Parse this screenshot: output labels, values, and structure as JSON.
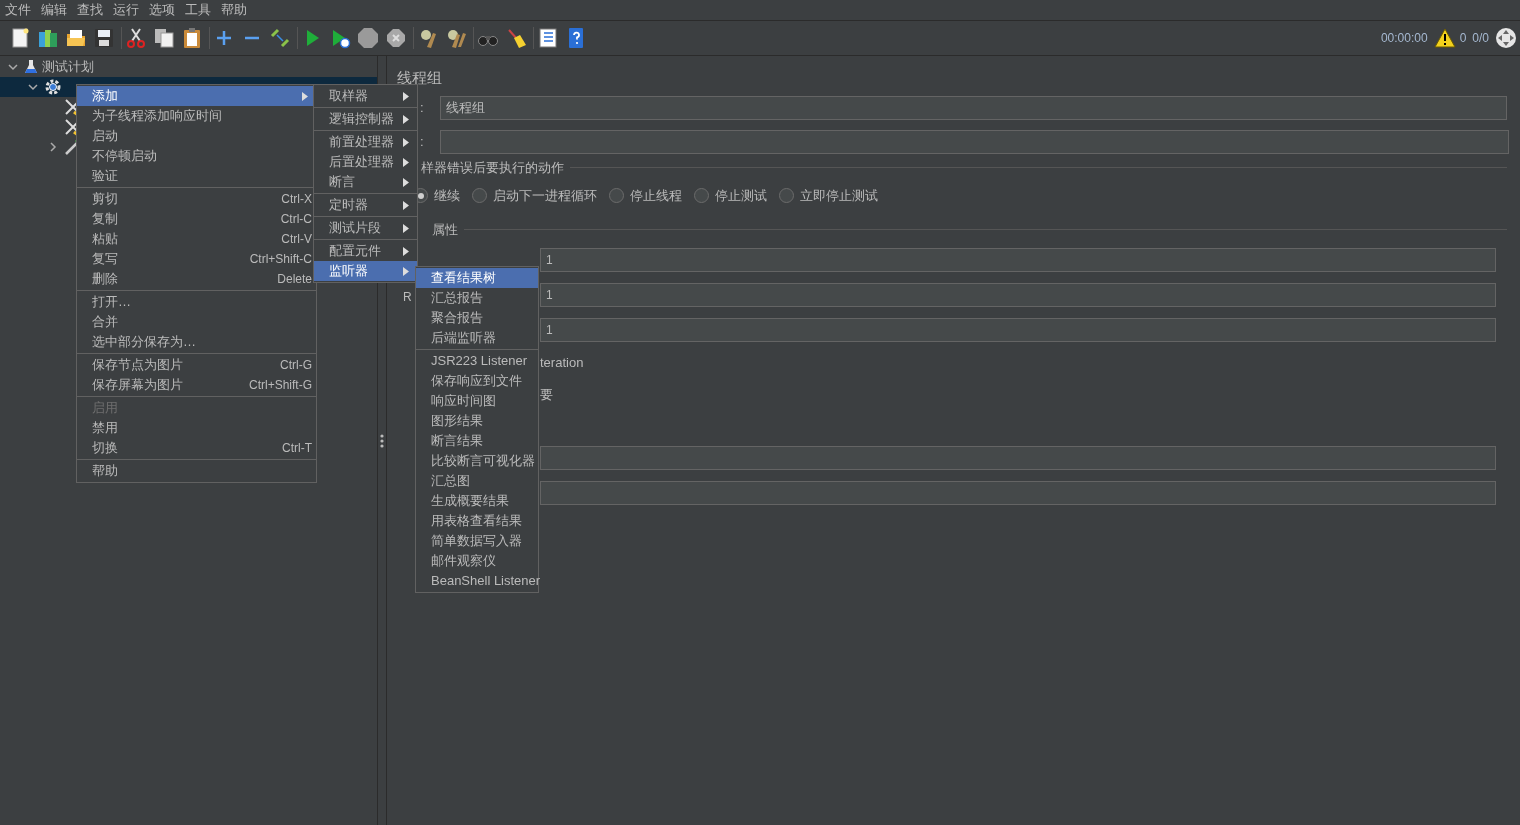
{
  "menu_bar": [
    "文件",
    "编辑",
    "查找",
    "运行",
    "选项",
    "工具",
    "帮助"
  ],
  "status": {
    "elapsed": "00:00:00",
    "warnings": "0",
    "threads": "0/0"
  },
  "tree": [
    {
      "kind": "plan",
      "label": "测试计划",
      "expanded": true,
      "selected": false,
      "children": [
        {
          "kind": "thread-group",
          "expanded": true,
          "selected": true,
          "children": [
            {
              "kind": "sampler",
              "selected": false
            },
            {
              "kind": "sampler",
              "selected": false
            },
            {
              "kind": "tool",
              "expanded": false,
              "selected": false
            }
          ]
        }
      ]
    }
  ],
  "context_menu": [
    [
      {
        "label": "添加",
        "selected": true,
        "submenu": true
      },
      {
        "label": "为子线程添加响应时间",
        "selected": false
      },
      {
        "label": "启动",
        "selected": false
      },
      {
        "label": "不停顿启动",
        "selected": false
      },
      {
        "label": "验证",
        "selected": false
      }
    ],
    [
      {
        "label": "剪切",
        "shortcut": "Ctrl-X",
        "selected": false
      },
      {
        "label": "复制",
        "shortcut": "Ctrl-C",
        "selected": false
      },
      {
        "label": "粘贴",
        "shortcut": "Ctrl-V",
        "selected": false
      },
      {
        "label": "复写",
        "shortcut": "Ctrl+Shift-C",
        "selected": false
      },
      {
        "label": "删除",
        "shortcut": "Delete",
        "selected": false
      }
    ],
    [
      {
        "label": "打开…",
        "selected": false
      },
      {
        "label": "合并",
        "selected": false
      },
      {
        "label": "选中部分保存为…",
        "selected": false
      }
    ],
    [
      {
        "label": "保存节点为图片",
        "shortcut": "Ctrl-G",
        "selected": false
      },
      {
        "label": "保存屏幕为图片",
        "shortcut": "Ctrl+Shift-G",
        "selected": false
      }
    ],
    [
      {
        "label": "启用",
        "disabled": true,
        "selected": false
      },
      {
        "label": "禁用",
        "selected": false
      },
      {
        "label": "切换",
        "shortcut": "Ctrl-T",
        "selected": false
      }
    ],
    [
      {
        "label": "帮助",
        "selected": false
      }
    ]
  ],
  "add_menu": [
    [
      {
        "label": "取样器",
        "selected": false
      }
    ],
    [
      {
        "label": "逻辑控制器",
        "selected": false
      }
    ],
    [
      {
        "label": "前置处理器",
        "selected": false
      },
      {
        "label": "后置处理器",
        "selected": false
      },
      {
        "label": "断言",
        "selected": false
      }
    ],
    [
      {
        "label": "定时器",
        "selected": false
      }
    ],
    [
      {
        "label": "测试片段",
        "selected": false
      }
    ],
    [
      {
        "label": "配置元件",
        "selected": false
      },
      {
        "label": "监听器",
        "selected": true
      }
    ]
  ],
  "listener_menu": [
    [
      {
        "label": "查看结果树",
        "selected": true
      },
      {
        "label": "汇总报告",
        "selected": false
      },
      {
        "label": "聚合报告",
        "selected": false
      },
      {
        "label": "后端监听器",
        "selected": false
      }
    ],
    [
      {
        "label": "JSR223 Listener",
        "selected": false
      },
      {
        "label": "保存响应到文件",
        "selected": false
      },
      {
        "label": "响应时间图",
        "selected": false
      },
      {
        "label": "图形结果",
        "selected": false
      },
      {
        "label": "断言结果",
        "selected": false
      },
      {
        "label": "比较断言可视化器",
        "selected": false
      },
      {
        "label": "汇总图",
        "selected": false
      },
      {
        "label": "生成概要结果",
        "selected": false
      },
      {
        "label": "用表格查看结果",
        "selected": false
      },
      {
        "label": "简单数据写入器",
        "selected": false
      },
      {
        "label": "邮件观察仪",
        "selected": false
      },
      {
        "label": "BeanShell Listener",
        "selected": false
      }
    ]
  ],
  "panel": {
    "title": "线程组",
    "name_field": {
      "label": ":",
      "value": "线程组"
    },
    "comment_field": {
      "label": ":"
    },
    "error_action": {
      "title": "样器错误后要执行的动作",
      "options": [
        {
          "label": "继续",
          "selected": true
        },
        {
          "label": "启动下一进程循环",
          "selected": false
        },
        {
          "label": "停止线程",
          "selected": false
        },
        {
          "label": "停止测试",
          "selected": false
        },
        {
          "label": "立即停止测试",
          "selected": false
        }
      ]
    },
    "properties": {
      "title": "属性",
      "rows": [
        {
          "kind": "field",
          "value": "1"
        },
        {
          "kind": "field",
          "label": "R",
          "value": "1"
        },
        {
          "kind": "field",
          "value": "1"
        },
        {
          "kind": "note",
          "text": "teration"
        },
        {
          "kind": "note",
          "text": "要"
        },
        {
          "kind": "field"
        },
        {
          "kind": "field"
        }
      ]
    }
  }
}
